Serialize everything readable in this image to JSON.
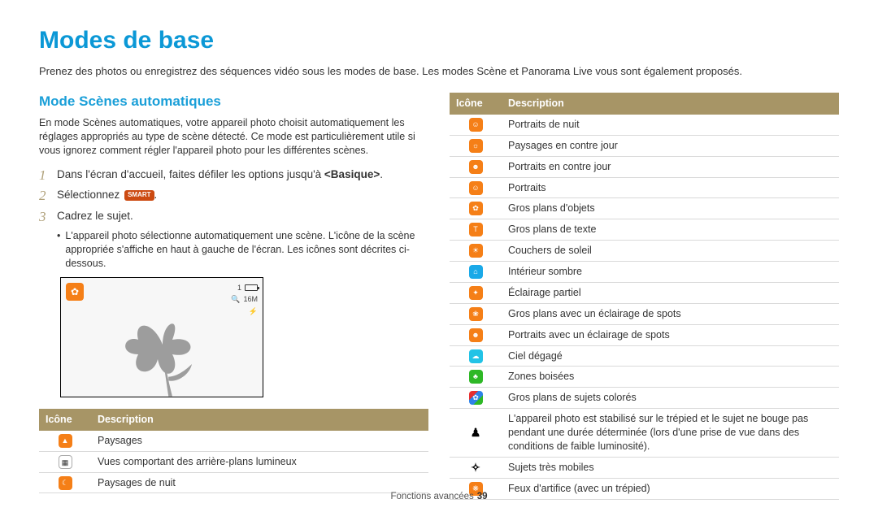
{
  "title": "Modes de base",
  "intro": "Prenez des photos ou enregistrez des séquences vidéo sous les modes de base. Les modes Scène et Panorama Live vous sont également proposés.",
  "left": {
    "heading": "Mode Scènes automatiques",
    "desc": "En mode Scènes automatiques, votre appareil photo choisit automatiquement les réglages appropriés au type de scène détecté. Ce mode est particulièrement utile si vous ignorez comment régler l'appareil photo pour les différentes scènes.",
    "steps": {
      "s1_pre": "Dans l'écran d'accueil, faites défiler les options jusqu'à ",
      "s1_bold": "<Basique>",
      "s1_post": ".",
      "s2_pre": "Sélectionnez ",
      "s2_badge": "SMART",
      "s2_post": ".",
      "s3": "Cadrez le sujet.",
      "s3_bullet": "L'appareil photo sélectionne automatiquement une scène. L'icône de la scène appropriée s'affiche en haut à gauche de l'écran. Les icônes sont décrites ci-dessous."
    },
    "screenshot": {
      "counter": "1",
      "zoom": "16M"
    },
    "table": {
      "h_icon": "Icône",
      "h_desc": "Description",
      "rows": [
        {
          "cls": "orange",
          "glyph": "▲",
          "desc": "Paysages"
        },
        {
          "cls": "white",
          "glyph": "▦",
          "desc": "Vues comportant des arrière-plans lumineux"
        },
        {
          "cls": "orange",
          "glyph": "☾",
          "desc": "Paysages de nuit"
        }
      ]
    }
  },
  "right": {
    "table": {
      "h_icon": "Icône",
      "h_desc": "Description",
      "rows": [
        {
          "cls": "orange",
          "glyph": "☺",
          "desc": "Portraits de nuit"
        },
        {
          "cls": "orange",
          "glyph": "☼",
          "desc": "Paysages en contre jour"
        },
        {
          "cls": "orange",
          "glyph": "☻",
          "desc": "Portraits en contre jour"
        },
        {
          "cls": "orange",
          "glyph": "☺",
          "desc": "Portraits"
        },
        {
          "cls": "orange",
          "glyph": "✿",
          "desc": "Gros plans d'objets"
        },
        {
          "cls": "orange",
          "glyph": "T",
          "desc": "Gros plans de texte"
        },
        {
          "cls": "orange",
          "glyph": "☀",
          "desc": "Couchers de soleil"
        },
        {
          "cls": "blue",
          "glyph": "⌂",
          "desc": "Intérieur sombre"
        },
        {
          "cls": "orange",
          "glyph": "✦",
          "desc": "Éclairage partiel"
        },
        {
          "cls": "orange",
          "glyph": "❀",
          "desc": "Gros plans avec un éclairage de spots"
        },
        {
          "cls": "orange",
          "glyph": "☻",
          "desc": "Portraits avec un éclairage de spots"
        },
        {
          "cls": "cyan",
          "glyph": "☁",
          "desc": "Ciel dégagé"
        },
        {
          "cls": "green",
          "glyph": "♣",
          "desc": "Zones boisées"
        },
        {
          "cls": "multi",
          "glyph": "✿",
          "desc": "Gros plans de sujets colorés"
        },
        {
          "cls": "black",
          "glyph": "♟",
          "desc": "L'appareil photo est stabilisé sur le trépied et le sujet ne bouge pas pendant une durée déterminée (lors d'une prise de vue dans des conditions de faible luminosité)."
        },
        {
          "cls": "black",
          "glyph": "✧",
          "desc": "Sujets très mobiles"
        },
        {
          "cls": "orange",
          "glyph": "❋",
          "desc": "Feux d'artifice (avec un trépied)"
        }
      ]
    }
  },
  "footer": {
    "label": "Fonctions avancées",
    "page": "39"
  }
}
